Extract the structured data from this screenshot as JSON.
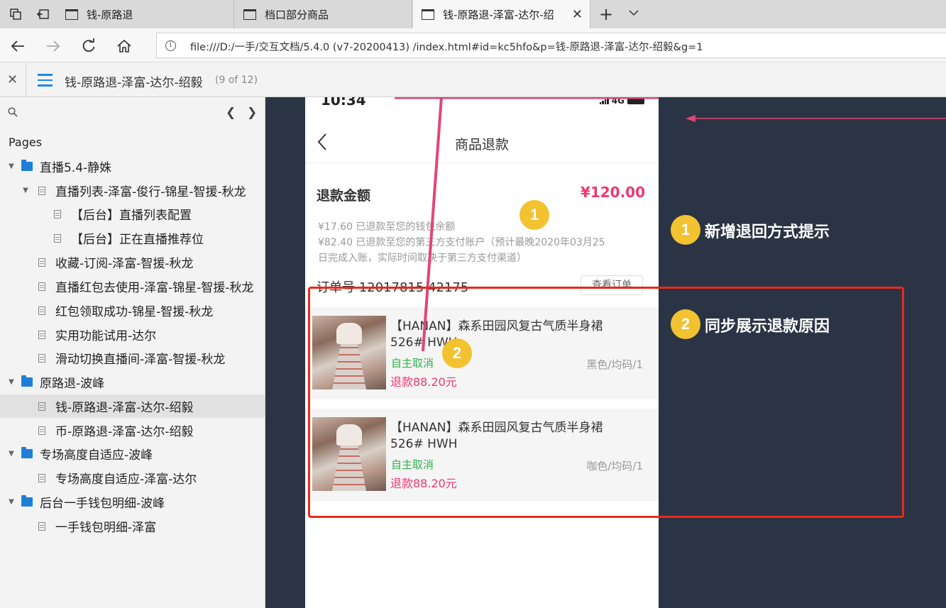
{
  "browser": {
    "tabs": [
      {
        "title": "钱-原路退"
      },
      {
        "title": "档口部分商品"
      },
      {
        "title": "钱-原路退-泽富-达尔-绍"
      }
    ],
    "url": "file:///D:/一手/交互文档/5.4.0  (v7-20200413)  /index.html#id=kc5hfo&p=钱-原路退-泽富-达尔-绍毅&g=1",
    "icons": {
      "collections": "tab-collections-icon",
      "set_aside": "set-aside-tabs-icon",
      "new_tab": "+",
      "tab_menu": "chevron-down-icon"
    }
  },
  "axure": {
    "page_title": "钱-原路退-泽富-达尔-绍毅",
    "page_count": "(9 of 12)"
  },
  "sidebar": {
    "heading": "Pages",
    "items": [
      {
        "label": "直播5.4-静姝"
      },
      {
        "label": "直播列表-泽富-俊行-锦星-智援-秋龙"
      },
      {
        "label": "【后台】直播列表配置"
      },
      {
        "label": "【后台】正在直播推荐位"
      },
      {
        "label": "收藏-订阅-泽富-智援-秋龙"
      },
      {
        "label": "直播红包去使用-泽富-锦星-智援-秋龙"
      },
      {
        "label": "红包领取成功-锦星-智援-秋龙"
      },
      {
        "label": "实用功能试用-达尔"
      },
      {
        "label": "滑动切换直播间-泽富-智援-秋龙"
      },
      {
        "label": "原路退-波峰"
      },
      {
        "label": "钱-原路退-泽富-达尔-绍毅"
      },
      {
        "label": "币-原路退-泽富-达尔-绍毅"
      },
      {
        "label": "专场高度自适应-波峰"
      },
      {
        "label": "专场高度自适应-泽富-达尔"
      },
      {
        "label": "后台一手钱包明细-波峰"
      },
      {
        "label": "一手钱包明细-泽富"
      }
    ],
    "selected_index": 10
  },
  "phone": {
    "status_time": "10:34",
    "network": "4G",
    "nav_title": "商品退款",
    "refund_label": "退款金额",
    "refund_amount": "¥120.00",
    "refund_notes": [
      "¥17.60  已退款至您的钱包余额",
      "¥82.40  已退款至您的第三方支付账户（预计最晚2020年03月25",
      "日完成入账，实际时间取决于第三方支付渠道）"
    ],
    "order_no": "订单号 12017815  42175",
    "view_order": "查看订单",
    "products": [
      {
        "title": "【HANAN】森系田园风复古气质半身裙526#  HWH",
        "status": "自主取消",
        "spec": "黑色/均码/1",
        "refund": "退款88.20元"
      },
      {
        "title": "【HANAN】森系田园风复古气质半身裙526#  HWH",
        "status": "自主取消",
        "spec": "咖色/均码/1",
        "refund": "退款88.20元"
      }
    ]
  },
  "annotations": [
    {
      "num": "1",
      "text": "新增退回方式提示"
    },
    {
      "num": "2",
      "text": "同步展示退款原因"
    }
  ],
  "colors": {
    "accent": "#1e88e5",
    "price": "#f0386e",
    "status": "#2fb24c",
    "badge": "#f2c230",
    "frame": "#e8291c",
    "canvas": "#2a3445",
    "arrow": "#e0457b"
  }
}
